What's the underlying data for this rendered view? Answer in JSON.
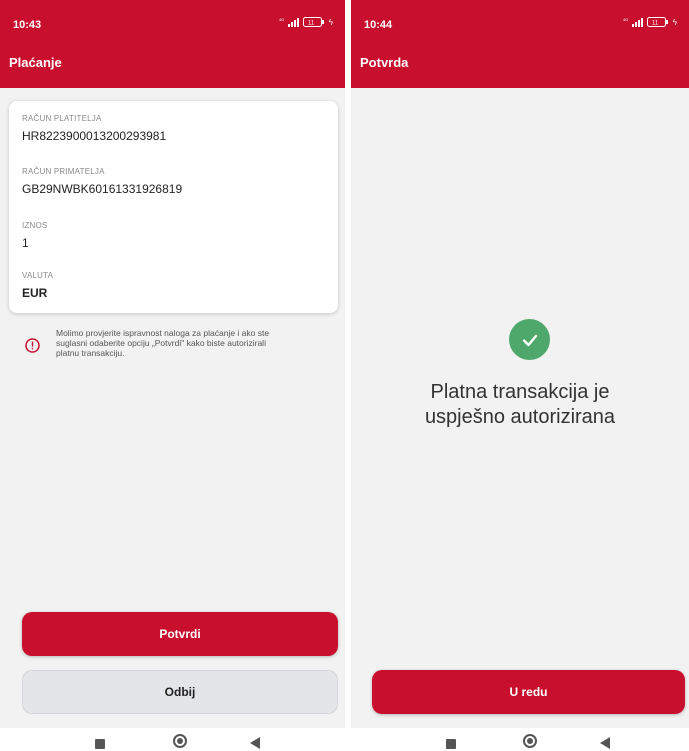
{
  "brand_color": "#c8102e",
  "left": {
    "status": {
      "time": "10:43",
      "network": "4G",
      "battery": "11"
    },
    "title": "Plaćanje",
    "fields": [
      {
        "label": "RAČUN PLATITELJA",
        "value": "HR8223900013200293981"
      },
      {
        "label": "RAČUN PRIMATELJA",
        "value": "GB29NWBK60161331926819"
      },
      {
        "label": "IZNOS",
        "value": "1"
      },
      {
        "label": "VALUTA",
        "value": "EUR"
      }
    ],
    "notice": {
      "icon": "info-icon",
      "lines": [
        "Molimo provjerite ispravnost naloga za plaćanje i ako ste",
        "suglasni odaberite opciju „Potvrdi\" kako biste autorizirali",
        "platnu transakciju."
      ]
    },
    "confirm_label": "Potvrdi",
    "reject_label": "Odbij"
  },
  "right": {
    "status": {
      "time": "10:44",
      "network": "4G",
      "battery": "11"
    },
    "title": "Potvrda",
    "success_icon": "checkmark-icon",
    "message_lines": [
      "Platna transakcija je",
      "uspješno autorizirana"
    ],
    "ok_label": "U redu"
  },
  "navbar": [
    "recents-icon",
    "home-icon",
    "back-icon"
  ]
}
